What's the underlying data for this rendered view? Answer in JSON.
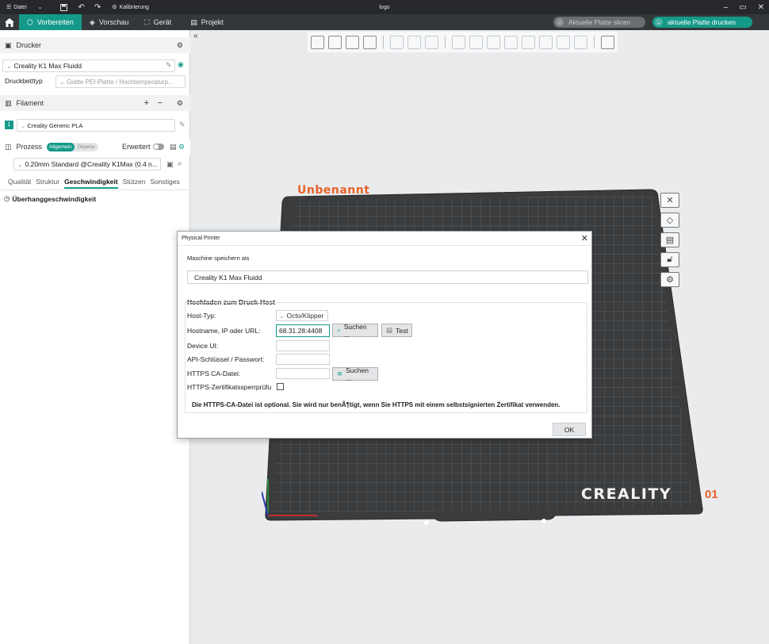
{
  "titlebar": {
    "menu_label": "Datei",
    "calibration_label": "Kalibrierung",
    "window_title": "logo"
  },
  "tabs": {
    "prepare": "Vorbereiten",
    "preview": "Vorschau",
    "device": "Gerät",
    "project": "Projekt",
    "slice_plate": "Aktuelle Platte slicen",
    "print_plate": "aktuelle Platte drucken"
  },
  "printer": {
    "section_title": "Drucker",
    "printer_name": "Creality K1 Max Fluidd",
    "bed_type_label": "Druckbetttyp",
    "bed_type_value": "Glatte PEI-Platte / Hochtemperaturp..."
  },
  "filament": {
    "section_title": "Filament",
    "slot_number": "1",
    "filament_name": "Creality Generic PLA"
  },
  "process": {
    "section_title": "Prozess",
    "seg_general": "Allgemein",
    "seg_objects": "Objekte",
    "advanced_label": "Erweitert",
    "profile": "0.20mm Standard @Creality K1Max (0.4 n...",
    "subtabs": [
      "Qualität",
      "Struktur",
      "Geschwindigkeit",
      "Stützen",
      "Sonstiges"
    ],
    "active_subtab": "Geschwindigkeit",
    "overhang_label": "Überhanggeschwindigkeit"
  },
  "viewport": {
    "plate_name": "Unbenannt",
    "plate_number": "01",
    "brand": "CREALITY"
  },
  "dialog": {
    "title": "Physical Printer",
    "save_label": "Maschine speichern als",
    "machine_name": "Creality K1 Max Fluidd",
    "upload_heading": "Hochladen zum Druck-Host",
    "host_type_label": "Host-Typ:",
    "host_type_value": "Octo/Klipper",
    "hostname_label": "Hostname, IP oder URL:",
    "hostname_value": "68.31.28:4408",
    "browse_label": "Suchen ...",
    "test_label": "Test",
    "device_ui_label": "Device UI:",
    "api_label": "API-Schlüssel / Passwort:",
    "https_ca_label": "HTTPS CA-Datei:",
    "https_browse_label": "Suchen ...",
    "revocation_label": "HTTPS-Zertifikatssperrprüfu",
    "info_note": "Die HTTPS-CA-Datei ist optional. Sie wird nur benÃ¶tigt, wenn Sie HTTPS mit einem selbstsignierten Zertifikat verwenden.",
    "ok_label": "OK"
  },
  "colors": {
    "accent": "#159a8a",
    "plate_name": "#e8612a",
    "bed": "#3a3c3e"
  }
}
